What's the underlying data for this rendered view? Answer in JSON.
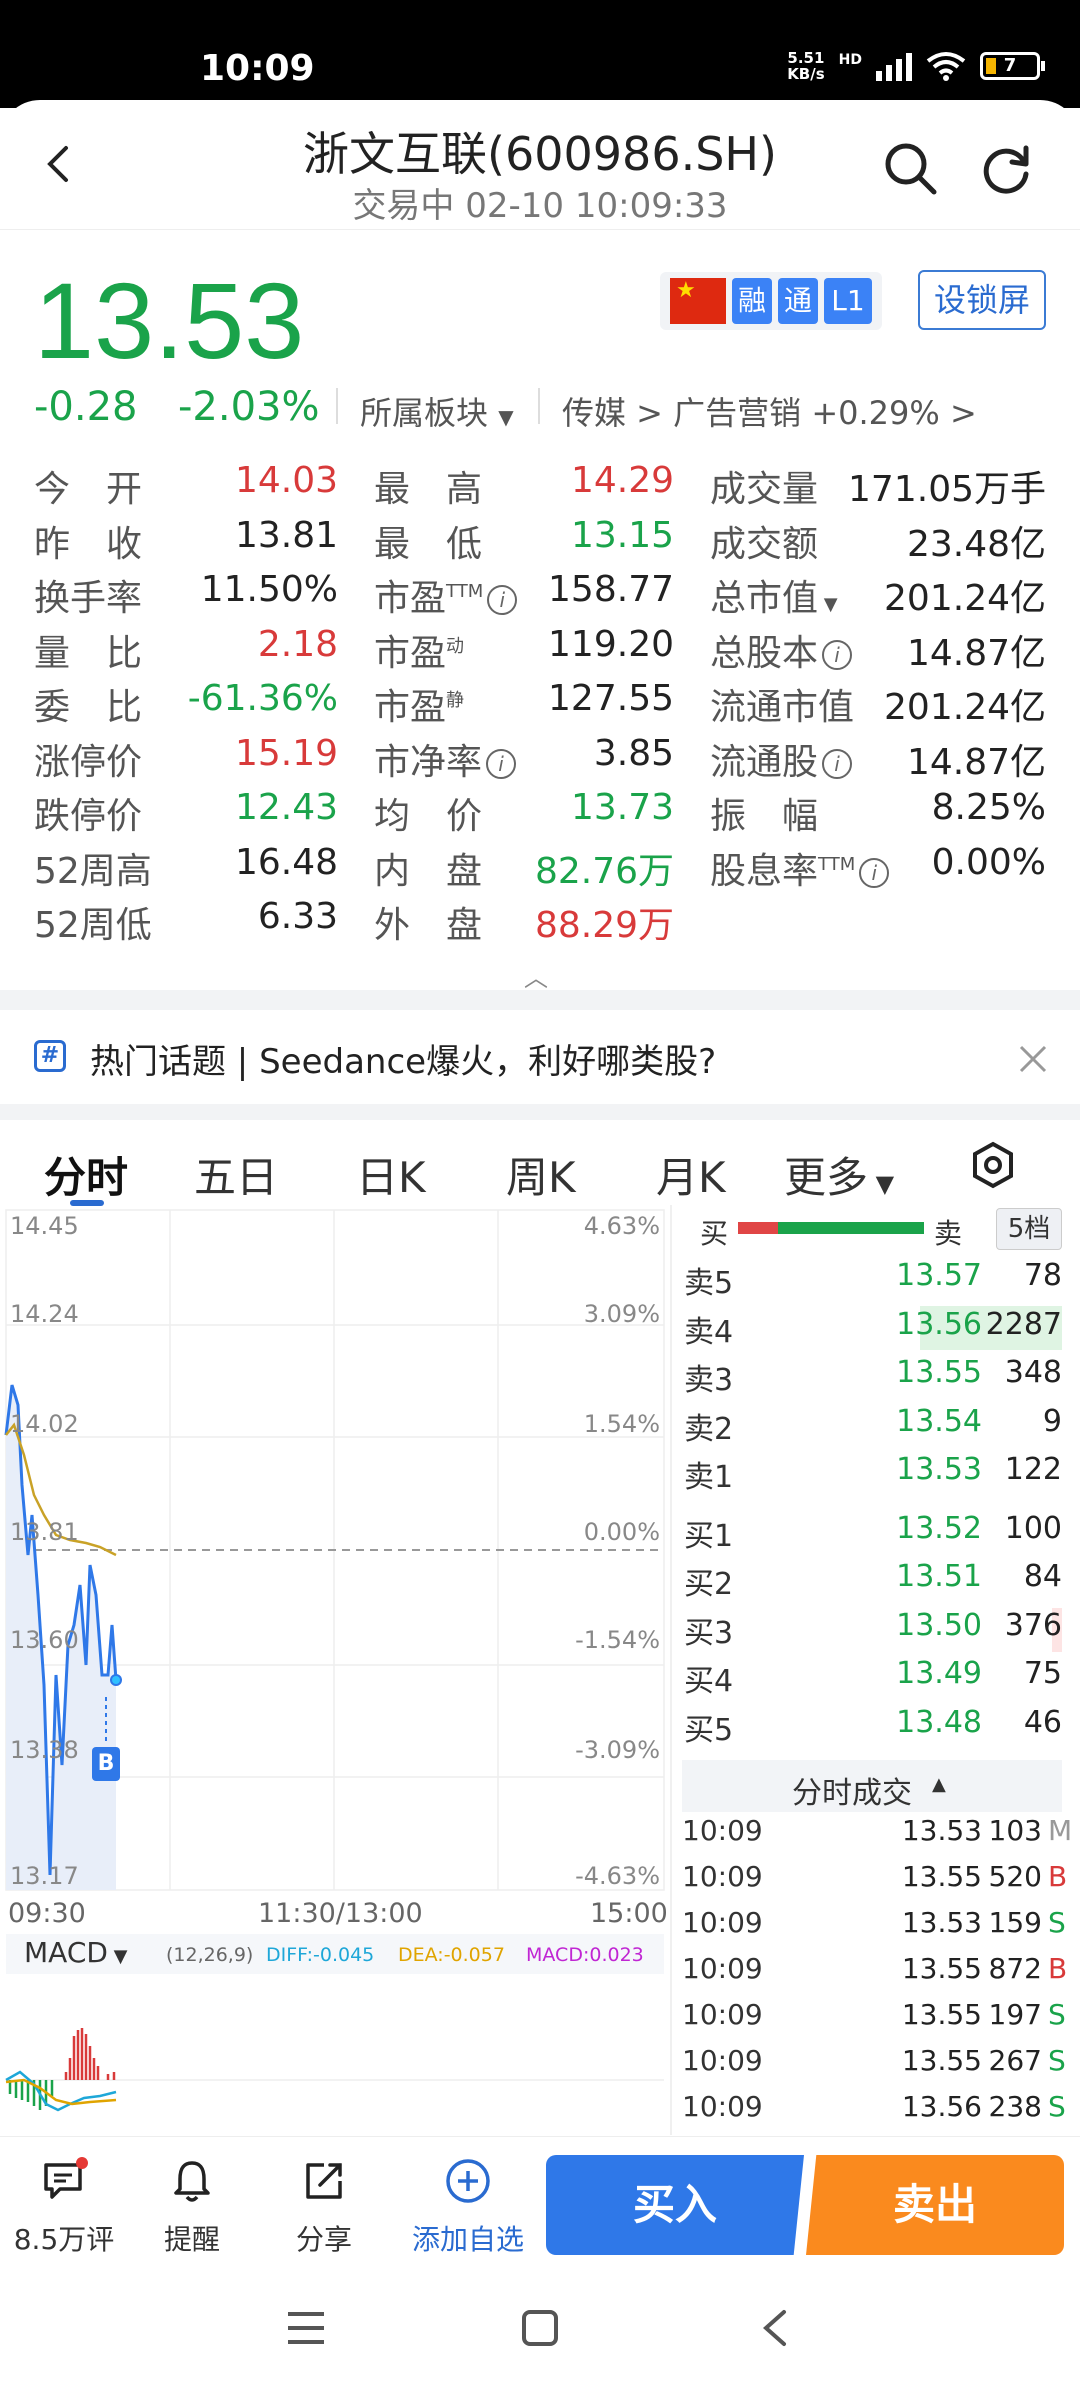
{
  "status": {
    "time": "10:09",
    "net_speed_value": "5.51",
    "net_speed_unit": "KB/s",
    "network": "HD",
    "battery": "7"
  },
  "header": {
    "title": "浙文互联(600986.SH)",
    "subtitle": "交易中 02-10 10:09:33"
  },
  "quote": {
    "price": "13.53",
    "change": "-0.28",
    "change_pct": "-2.03%",
    "sector_label": "所属板块",
    "sector_path": "传媒 > 广告营销 +0.29% >",
    "badges": [
      "融",
      "通",
      "L1"
    ],
    "lock_screen": "设锁屏",
    "col1": [
      {
        "label": "今　开",
        "value": "14.03",
        "color": "red"
      },
      {
        "label": "昨　收",
        "value": "13.81",
        "color": "dark"
      },
      {
        "label": "换手率",
        "value": "11.50%",
        "color": "dark"
      },
      {
        "label": "量　比",
        "value": "2.18",
        "color": "red"
      },
      {
        "label": "委　比",
        "value": "-61.36%",
        "color": "green"
      },
      {
        "label": "涨停价",
        "value": "15.19",
        "color": "red"
      },
      {
        "label": "跌停价",
        "value": "12.43",
        "color": "green"
      },
      {
        "label": "52周高",
        "value": "16.48",
        "color": "dark"
      },
      {
        "label": "52周低",
        "value": "6.33",
        "color": "dark"
      }
    ],
    "col2": [
      {
        "label": "最　高",
        "value": "14.29",
        "color": "red"
      },
      {
        "label": "最　低",
        "value": "13.15",
        "color": "green"
      },
      {
        "label": "市盈TTM",
        "value": "158.77",
        "color": "dark"
      },
      {
        "label": "市盈动",
        "value": "119.20",
        "color": "dark"
      },
      {
        "label": "市盈静",
        "value": "127.55",
        "color": "dark"
      },
      {
        "label": "市净率",
        "value": "3.85",
        "color": "dark"
      },
      {
        "label": "均　价",
        "value": "13.73",
        "color": "green"
      },
      {
        "label": "内　盘",
        "value": "82.76万",
        "color": "green"
      },
      {
        "label": "外　盘",
        "value": "88.29万",
        "color": "red"
      }
    ],
    "col3": [
      {
        "label": "成交量",
        "value": "171.05万手"
      },
      {
        "label": "成交额",
        "value": "23.48亿"
      },
      {
        "label": "总市值",
        "value": "201.24亿"
      },
      {
        "label": "总股本",
        "value": "14.87亿"
      },
      {
        "label": "流通市值",
        "value": "201.24亿"
      },
      {
        "label": "流通股",
        "value": "14.87亿"
      },
      {
        "label": "振　幅",
        "value": "8.25%"
      },
      {
        "label": "股息率TTM",
        "value": "0.00%"
      }
    ]
  },
  "topic": {
    "text": "热门话题 | Seedance爆火，利好哪类股?"
  },
  "tabs": [
    "分时",
    "五日",
    "日K",
    "周K",
    "月K",
    "更多"
  ],
  "chart": {
    "y_prices": [
      "14.45",
      "14.24",
      "14.02",
      "13.81",
      "13.60",
      "13.38",
      "13.17"
    ],
    "y_pcts": [
      "4.63%",
      "3.09%",
      "1.54%",
      "0.00%",
      "-1.54%",
      "-3.09%",
      "-4.63%"
    ],
    "x_labels": [
      "09:30",
      "11:30/13:00",
      "15:00"
    ],
    "marker": "B",
    "macd": {
      "label": "MACD",
      "params": "(12,26,9)",
      "diff": "DIFF:-0.045",
      "dea": "DEA:-0.057",
      "macd": "MACD:0.023"
    }
  },
  "orderbook": {
    "buy_label": "买",
    "sell_label": "卖",
    "depth": "5档",
    "asks": [
      {
        "label": "卖5",
        "price": "13.57",
        "vol": "78"
      },
      {
        "label": "卖4",
        "price": "13.56",
        "vol": "2287"
      },
      {
        "label": "卖3",
        "price": "13.55",
        "vol": "348"
      },
      {
        "label": "卖2",
        "price": "13.54",
        "vol": "9"
      },
      {
        "label": "卖1",
        "price": "13.53",
        "vol": "122"
      }
    ],
    "bids": [
      {
        "label": "买1",
        "price": "13.52",
        "vol": "100"
      },
      {
        "label": "买2",
        "price": "13.51",
        "vol": "84"
      },
      {
        "label": "买3",
        "price": "13.50",
        "vol": "376"
      },
      {
        "label": "买4",
        "price": "13.49",
        "vol": "75"
      },
      {
        "label": "买5",
        "price": "13.48",
        "vol": "46"
      }
    ],
    "ticks_title": "分时成交",
    "ticks": [
      {
        "time": "10:09",
        "price": "13.53",
        "vol": "103",
        "flag": "M"
      },
      {
        "time": "10:09",
        "price": "13.55",
        "vol": "520",
        "flag": "B"
      },
      {
        "time": "10:09",
        "price": "13.53",
        "vol": "159",
        "flag": "S"
      },
      {
        "time": "10:09",
        "price": "13.55",
        "vol": "872",
        "flag": "B"
      },
      {
        "time": "10:09",
        "price": "13.55",
        "vol": "197",
        "flag": "S"
      },
      {
        "time": "10:09",
        "price": "13.55",
        "vol": "267",
        "flag": "S"
      },
      {
        "time": "10:09",
        "price": "13.56",
        "vol": "238",
        "flag": "S"
      }
    ]
  },
  "bottom": {
    "comments": "8.5万评",
    "alert": "提醒",
    "share": "分享",
    "watch": "添加自选",
    "buy": "买入",
    "sell": "卖出"
  },
  "colors": {
    "green": "#1aa34a",
    "red": "#d83a3a",
    "blue": "#2f78e8",
    "orange": "#fa8a1e"
  }
}
